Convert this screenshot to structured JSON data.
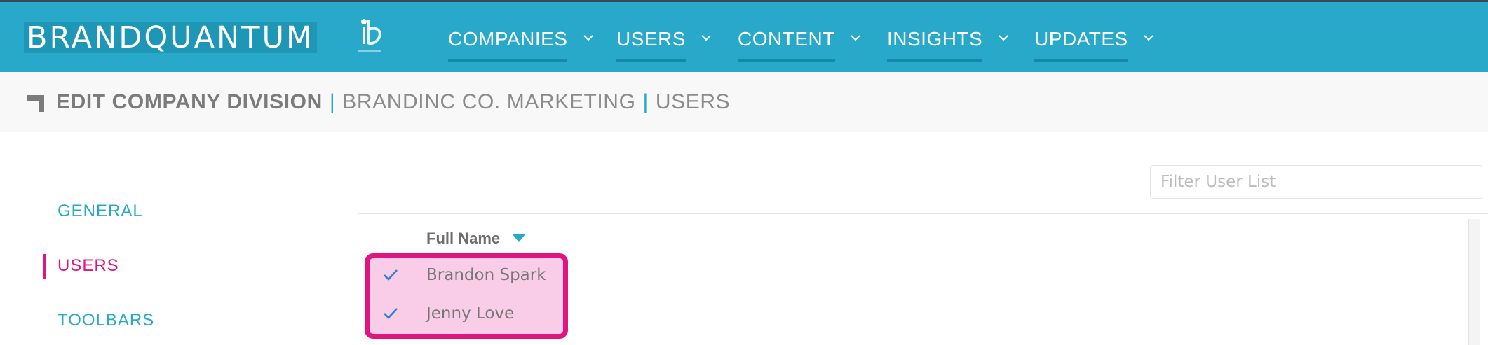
{
  "brand": {
    "logo_text": "BRANDQUANTUM"
  },
  "nav": {
    "items": [
      {
        "label": "COMPANIES"
      },
      {
        "label": "USERS"
      },
      {
        "label": "CONTENT"
      },
      {
        "label": "INSIGHTS"
      },
      {
        "label": "UPDATES"
      }
    ]
  },
  "breadcrumb": {
    "title": "EDIT COMPANY DIVISION",
    "separator": "|",
    "division": "BRANDINC CO. MARKETING",
    "section": "USERS"
  },
  "sidebar": {
    "items": [
      {
        "label": "GENERAL",
        "active": false
      },
      {
        "label": "USERS",
        "active": true
      },
      {
        "label": "TOOLBARS",
        "active": false
      }
    ]
  },
  "user_list": {
    "filter_placeholder": "Filter User List",
    "filter_value": "",
    "columns": [
      {
        "label": "Full Name",
        "sort": "descending"
      }
    ],
    "rows": [
      {
        "name": "Brandon Spark",
        "selected": true
      },
      {
        "name": "Jenny Love",
        "selected": true
      }
    ]
  },
  "icons": {
    "nav_dropdown": "chevron-down-icon",
    "sort": "sort-down-icon",
    "row_check": "check-icon",
    "corner": "corner-bracket-icon"
  },
  "colors": {
    "primary": "#29a9c9",
    "nav_underline": "#1589a8",
    "accent": "#e0157f",
    "highlight_fill": "#f9cde7",
    "check": "#2f7fd1"
  }
}
